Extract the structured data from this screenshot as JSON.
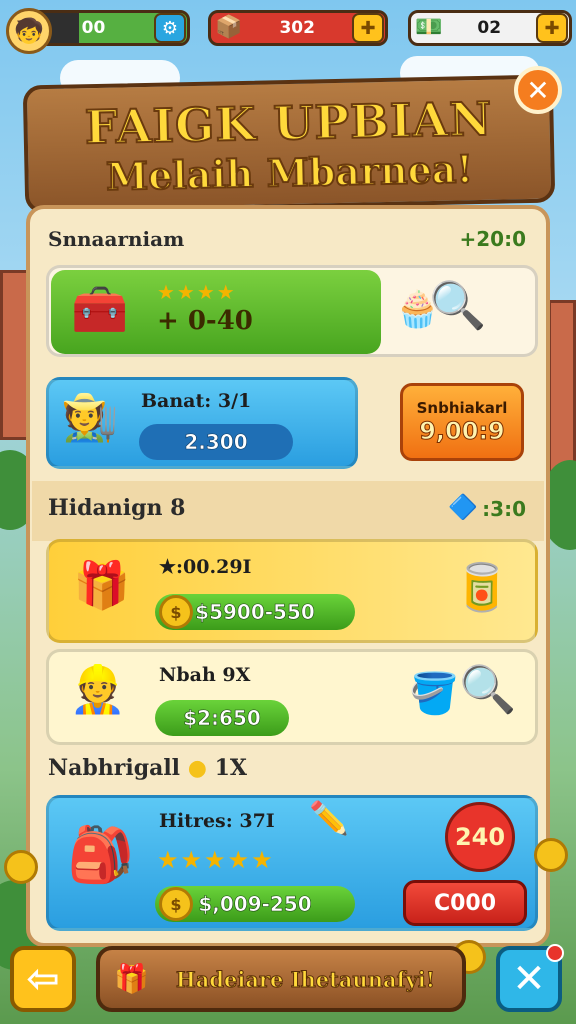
{
  "hud": {
    "coins": "00",
    "chests": "302",
    "cash": "02",
    "avatar_icon": "🧒",
    "coin_icon": "🪙",
    "chest_icon": "📦",
    "cash_icon": "💵"
  },
  "title": {
    "line1": "FAIGK UPBIAN",
    "line2": "Melaih Mbarnea!"
  },
  "section1": {
    "heading": "Snnaarniam",
    "value": "+20:0",
    "card": {
      "stars": "★★★★",
      "amount": "+ 0-40"
    },
    "player_card": {
      "label": "Banat: 3/1",
      "bar": "2.300"
    },
    "offer_button": {
      "title": "Snbhiakarl",
      "value": "9,00:9"
    }
  },
  "section2": {
    "heading": "Hidanign 8",
    "value": ":3:0",
    "card1": {
      "label": "★:00.29I",
      "bar": "$5900-550"
    },
    "card2": {
      "label": "Nbah 9X",
      "bar": "$2:650"
    }
  },
  "section3": {
    "heading": "Nabhrigall",
    "heading_suffix": "1X",
    "card": {
      "label": "Hitres: 37I",
      "stars": "★★★★★",
      "bar": "$,009-250",
      "badge": "240",
      "button": "C000"
    }
  },
  "bottom": {
    "back_arrow": "⇦",
    "banner": "Hadeiare Ihetaunafyi!",
    "close": "✕"
  },
  "colors": {
    "wood": "#8b5529",
    "gold": "#ffd93b",
    "green_bar": "#4dbb2a",
    "blue_card": "#3aaee8",
    "orange": "#f57d1f"
  }
}
